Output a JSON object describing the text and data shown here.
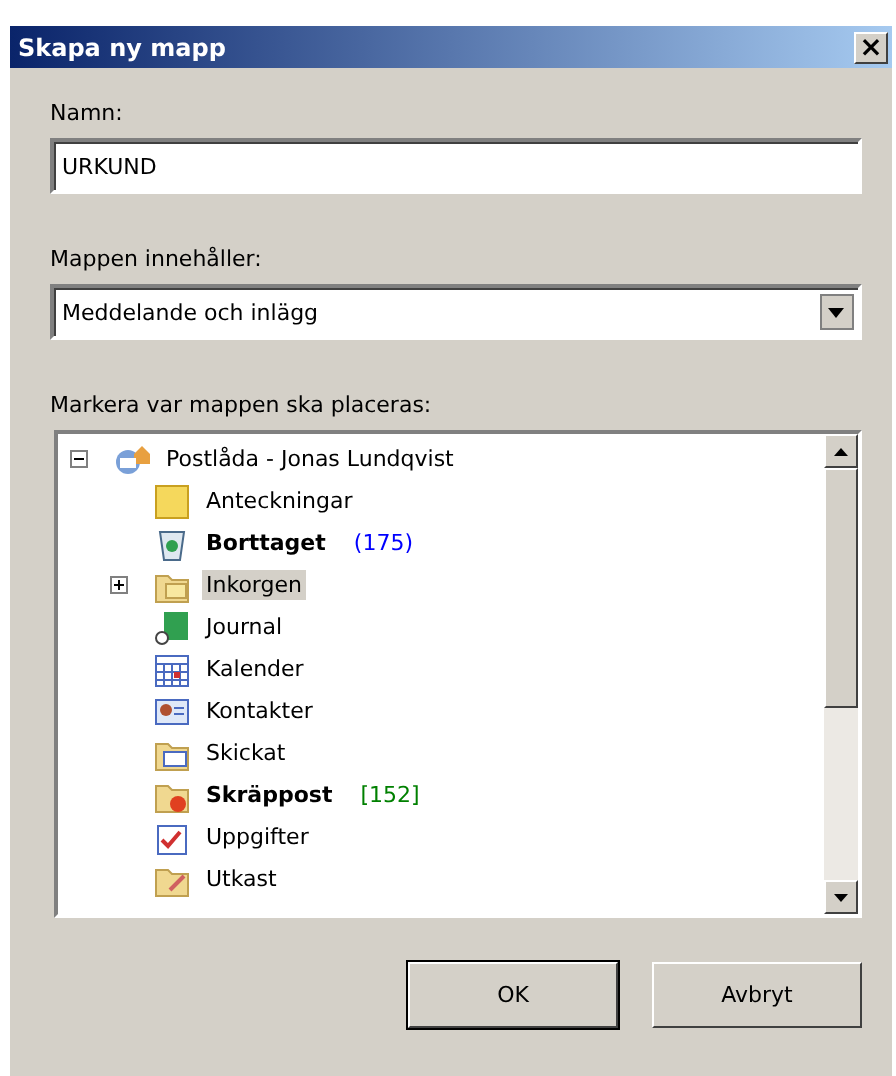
{
  "window": {
    "title": "Skapa ny mapp",
    "close": "×"
  },
  "name_field": {
    "label": "Namn:",
    "value": "URKUND"
  },
  "contents_field": {
    "label": "Mappen innehåller:",
    "value": "Meddelande och inlägg"
  },
  "tree": {
    "label": "Markera var mappen ska placeras:",
    "items": [
      {
        "label": "Postlåda - Jonas Lundqvist",
        "kind": "mailbox",
        "bold": false,
        "selected": false,
        "expanded": true,
        "children": [
          {
            "label": "Anteckningar",
            "kind": "notes",
            "bold": false,
            "selected": false
          },
          {
            "label": "Borttaget",
            "kind": "trash",
            "bold": true,
            "selected": false,
            "count": "(175)",
            "color": "#0000ff"
          },
          {
            "label": "Inkorgen",
            "kind": "inbox",
            "bold": false,
            "selected": true,
            "expanded": false
          },
          {
            "label": "Journal",
            "kind": "journal",
            "bold": false,
            "selected": false
          },
          {
            "label": "Kalender",
            "kind": "calendar",
            "bold": false,
            "selected": false
          },
          {
            "label": "Kontakter",
            "kind": "contacts",
            "bold": false,
            "selected": false
          },
          {
            "label": "Skickat",
            "kind": "sent",
            "bold": false,
            "selected": false
          },
          {
            "label": "Skräppost",
            "kind": "junk",
            "bold": true,
            "selected": false,
            "count": "[152]",
            "color": "#008000"
          },
          {
            "label": "Uppgifter",
            "kind": "tasks",
            "bold": false,
            "selected": false
          },
          {
            "label": "Utkast",
            "kind": "drafts",
            "bold": false,
            "selected": false
          }
        ]
      }
    ]
  },
  "buttons": [
    {
      "label": "OK",
      "default": true
    },
    {
      "label": "Avbryt",
      "default": false
    }
  ]
}
